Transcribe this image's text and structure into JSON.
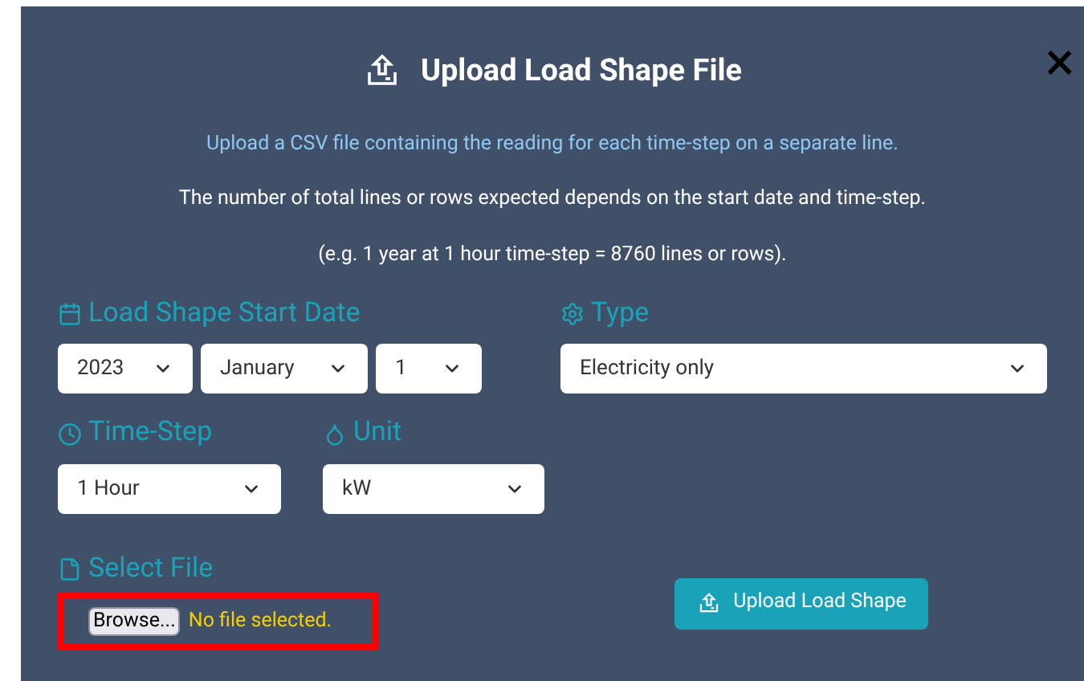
{
  "dialog": {
    "title": "Upload Load Shape File",
    "close": "×"
  },
  "instructions": [
    {
      "text": "Upload a CSV file containing the reading for each time-step on a separate line.",
      "kind": "accent"
    },
    {
      "text": "The number of total lines or rows expected depends on the start date and time-step.",
      "kind": "plain"
    },
    {
      "text": "(e.g. 1 year at 1 hour time-step = 8760 lines or rows).",
      "kind": "plain"
    }
  ],
  "start_date": {
    "label": "Load Shape Start Date",
    "year": "2023",
    "month": "January",
    "day": "1"
  },
  "type": {
    "label": "Type",
    "value": "Electricity only"
  },
  "time_step": {
    "label": "Time-Step",
    "value": "1 Hour"
  },
  "unit": {
    "label": "Unit",
    "value": "kW"
  },
  "select_file": {
    "label": "Select File",
    "browse": "Browse...",
    "status": "No file selected.",
    "highlighted": true
  },
  "upload_button": "Upload Load Shape"
}
